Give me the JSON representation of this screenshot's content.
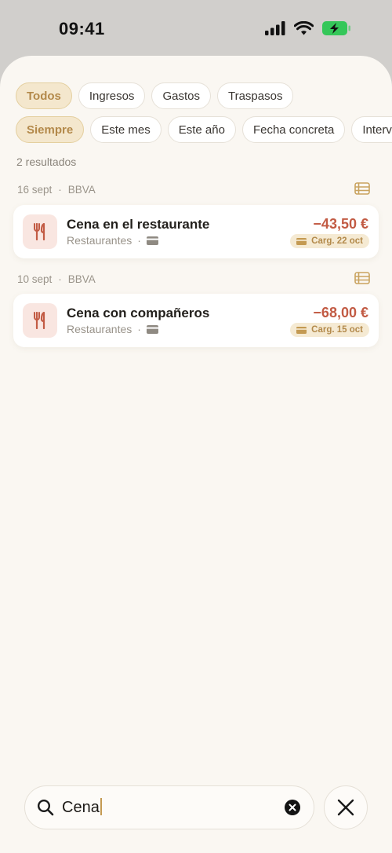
{
  "status_bar": {
    "time": "09:41"
  },
  "filters": {
    "type_chips": [
      "Todos",
      "Ingresos",
      "Gastos",
      "Traspasos"
    ],
    "period_chips": [
      "Siempre",
      "Este mes",
      "Este año",
      "Fecha concreta",
      "Intervalo"
    ]
  },
  "results": {
    "count_label": "2 resultados",
    "groups": [
      {
        "date": "16 sept",
        "account": "BBVA",
        "tx": {
          "title": "Cena en el restaurante",
          "category": "Restaurantes",
          "amount": "−43,50 €",
          "charge": "Carg. 22 oct"
        }
      },
      {
        "date": "10 sept",
        "account": "BBVA",
        "tx": {
          "title": "Cena con compañeros",
          "category": "Restaurantes",
          "amount": "−68,00 €",
          "charge": "Carg. 15 oct"
        }
      }
    ]
  },
  "search": {
    "query": "Cena"
  },
  "colors": {
    "accent": "#b3894a",
    "amount_negative": "#c25b44",
    "sheet_bg": "#faf7f2"
  },
  "icons": [
    "cellular-signal-icon",
    "wifi-icon",
    "battery-charging-icon",
    "list-icon",
    "fork-knife-icon",
    "credit-card-icon",
    "search-icon",
    "clear-icon",
    "close-icon"
  ]
}
